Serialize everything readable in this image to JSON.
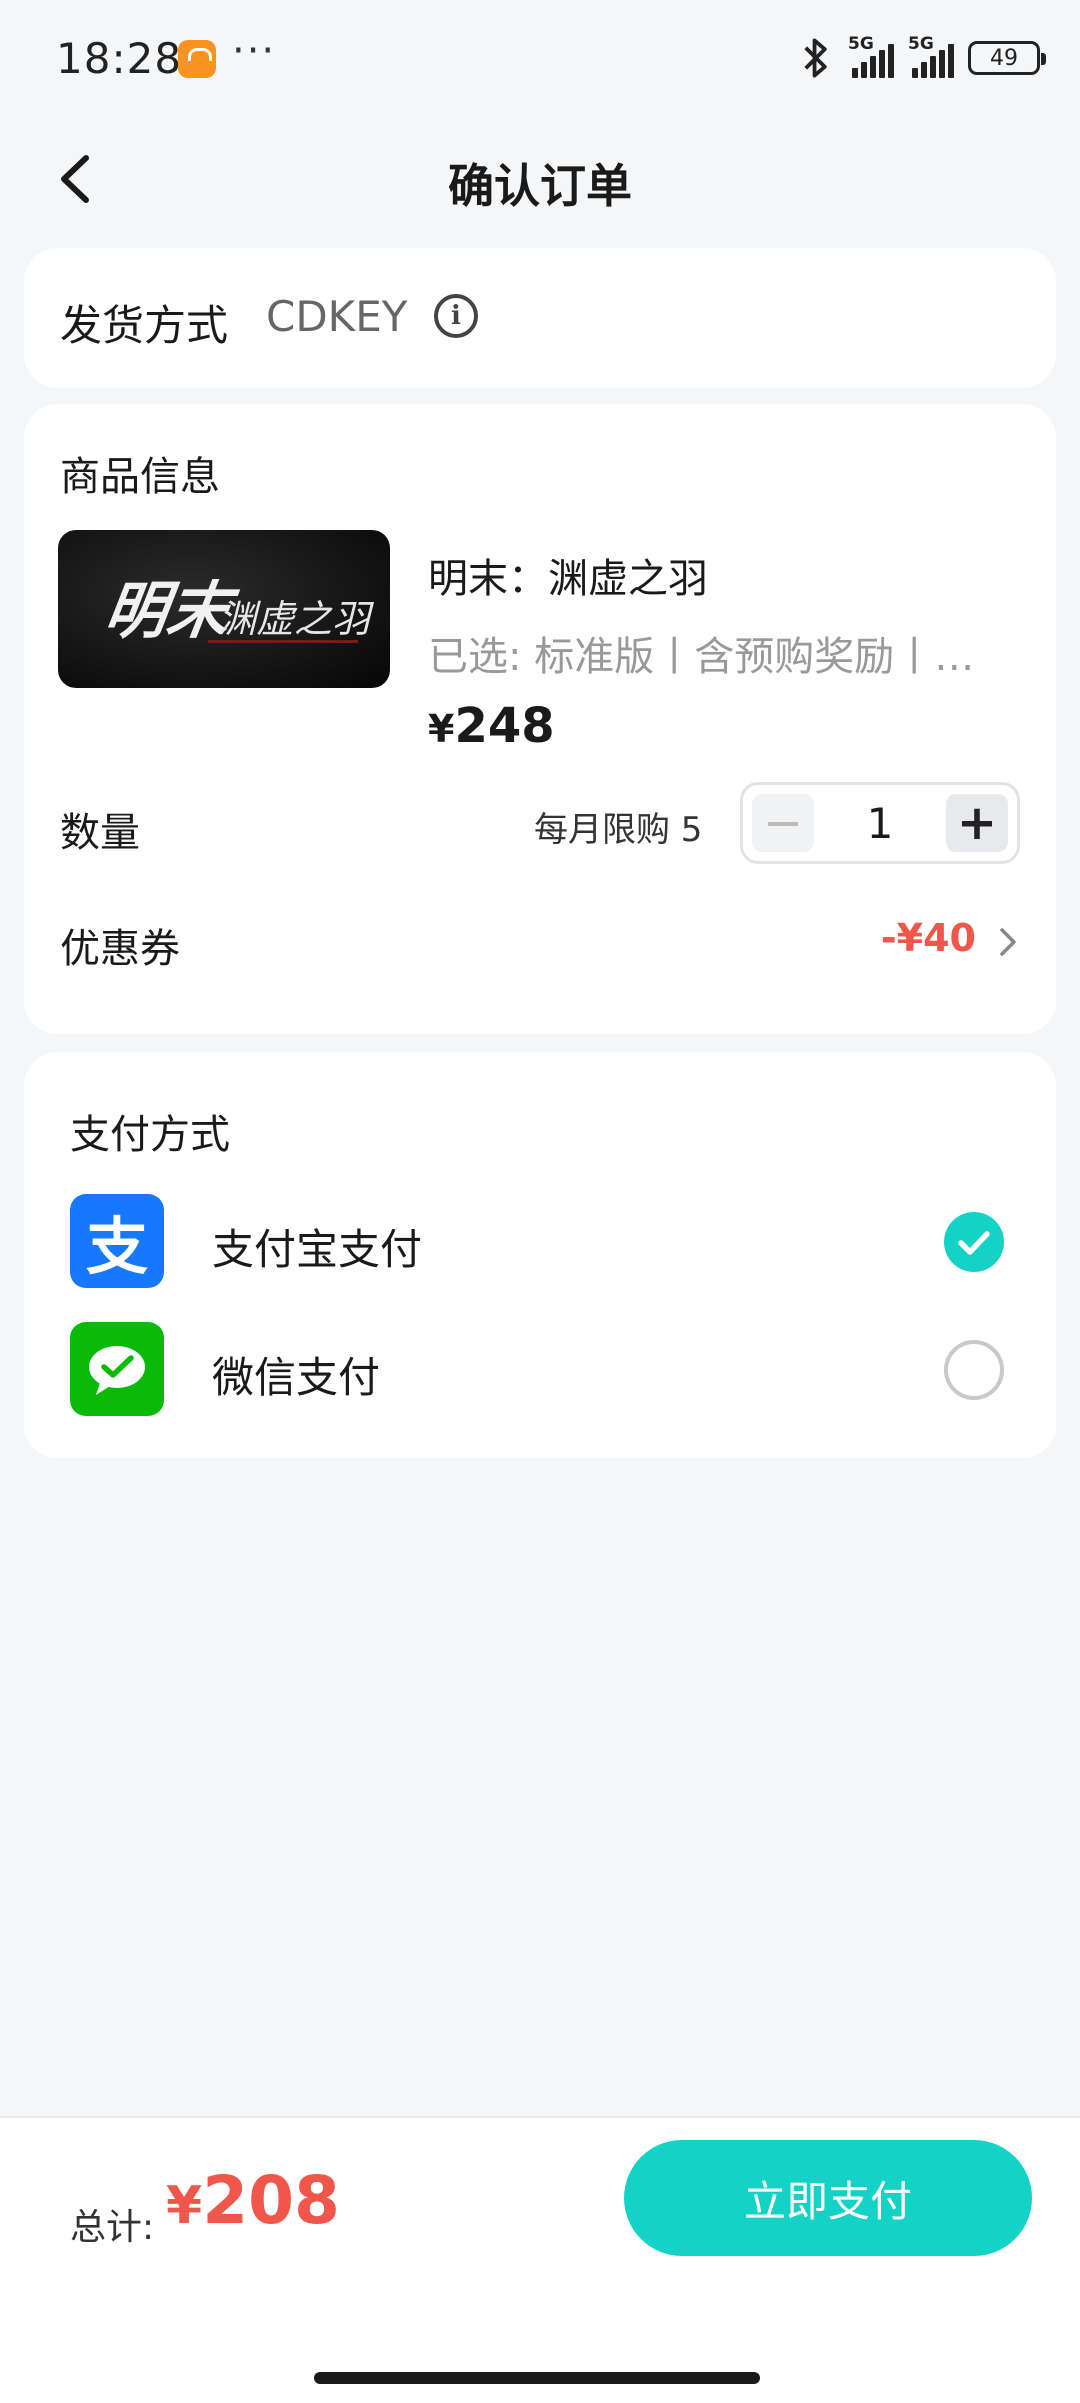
{
  "status_bar": {
    "time": "18:28",
    "dots": "···",
    "network_1": "5G",
    "network_2": "5G",
    "battery": "49",
    "icons": [
      "shopping-app-icon",
      "bluetooth-icon",
      "signal-icon",
      "battery-icon"
    ]
  },
  "header": {
    "title": "确认订单"
  },
  "shipping": {
    "label": "发货方式",
    "value": "CDKEY",
    "info_symbol": "i"
  },
  "product": {
    "section_title": "商品信息",
    "cover_text_main": "明末",
    "cover_text_sub": "渊虚之羽",
    "name": "明末：渊虚之羽",
    "spec": "已选: 标准版丨含预购奖励丨…",
    "price_currency": "¥",
    "price": "248",
    "quantity_label": "数量",
    "limit_text": "每月限购 5",
    "quantity": "1",
    "minus": "−",
    "plus": "+",
    "coupon_label": "优惠券",
    "coupon_value": "-¥40"
  },
  "payment": {
    "title": "支付方式",
    "methods": [
      {
        "name": "支付宝支付",
        "icon": "alipay-icon",
        "icon_glyph": "支",
        "selected": true
      },
      {
        "name": "微信支付",
        "icon": "wechat-pay-icon",
        "selected": false
      }
    ]
  },
  "footer": {
    "total_label": "总计:",
    "total_currency": "¥",
    "total_value": "208",
    "pay_button": "立即支付"
  },
  "colors": {
    "accent": "#14d3c6",
    "price_red": "#f0574a",
    "alipay_blue": "#1677ff",
    "wechat_green": "#09bb07",
    "background": "#f5f6f8"
  }
}
